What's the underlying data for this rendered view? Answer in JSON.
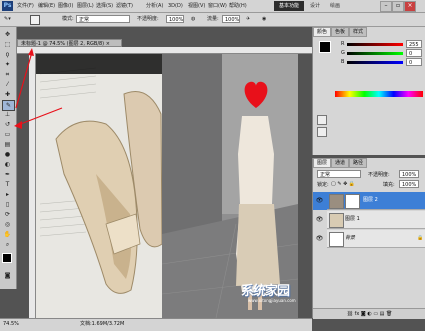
{
  "app": {
    "logo": "Ps"
  },
  "menu": [
    "文件(F)",
    "编辑(E)",
    "图像(I)",
    "图层(L)",
    "选择(S)",
    "滤镜(T)",
    "分析(A)",
    "3D(D)",
    "视图(V)",
    "窗口(W)",
    "帮助(H)"
  ],
  "titlebar_controls": {
    "zoom": "74.5",
    "workspace": "基本功能",
    "links": [
      "设计",
      "绘画"
    ]
  },
  "options_bar": {
    "mode_label": "模式:",
    "mode_value": "正常",
    "opacity_label": "不透明度:",
    "opacity_value": "100%",
    "flow_label": "流量:",
    "flow_value": "100%"
  },
  "document": {
    "tab_title": "未标题-1 @ 74.5% (图层 2, RGB/8)",
    "close": "×"
  },
  "status": {
    "zoom": "74.5%",
    "doc": "文档:1.69M/3.72M"
  },
  "color_panel": {
    "tabs": [
      "颜色",
      "色板",
      "样式"
    ],
    "channels": [
      "R",
      "G",
      "B"
    ],
    "values": [
      "255",
      "0",
      "0"
    ]
  },
  "layers_panel": {
    "tabs": [
      "图层",
      "通道",
      "路径"
    ],
    "blend": "正常",
    "opacity_label": "不透明度:",
    "opacity": "100%",
    "lock_label": "锁定:",
    "fill_label": "填充:",
    "fill": "100%",
    "layers": [
      {
        "name": "图层 2",
        "selected": true
      },
      {
        "name": "图层 1",
        "selected": false
      },
      {
        "name": "背景",
        "selected": false
      }
    ]
  },
  "watermark": {
    "text": "系统家园",
    "url": "www.xitongjiayuan.com"
  },
  "colors": {
    "accent": "#0a6ad8",
    "heart": "#e8101a",
    "selection": "#3d7fd6"
  }
}
